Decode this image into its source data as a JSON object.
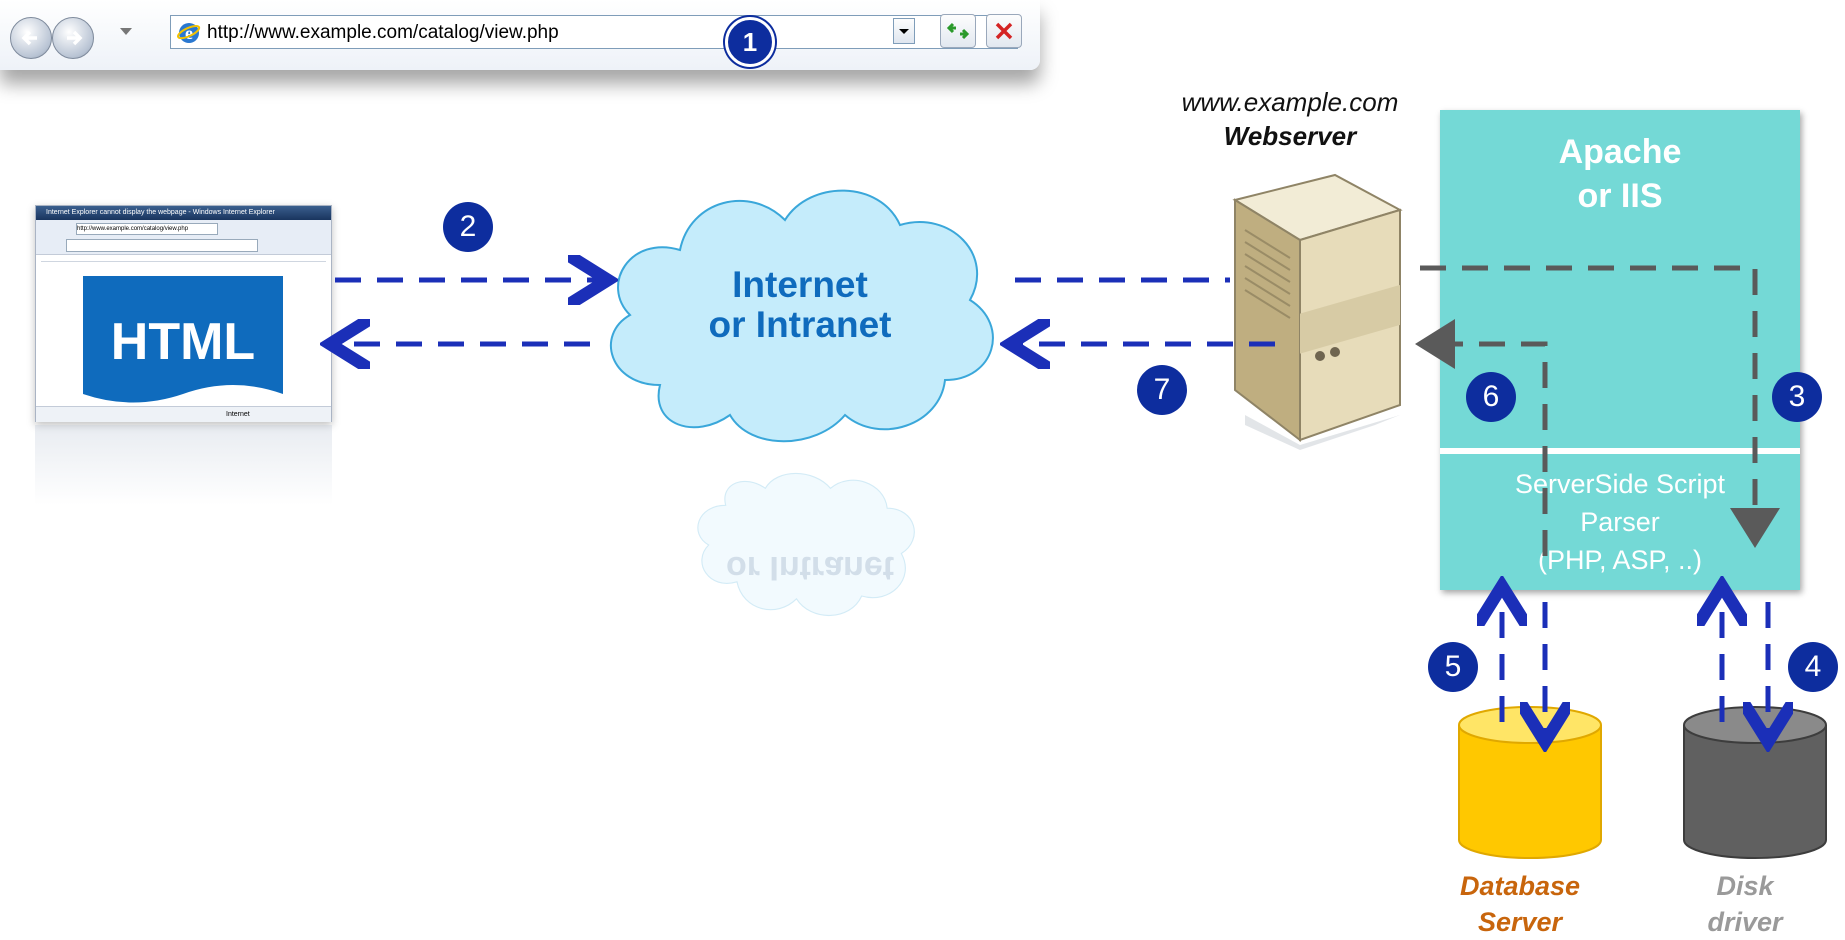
{
  "browser": {
    "url": "http://www.example.com/catalog/view.php",
    "back_icon": "back-arrow-icon",
    "forward_icon": "forward-arrow-icon",
    "dropdown_icon": "chevron-down-icon",
    "refresh_icon": "refresh-icon",
    "stop_icon": "close-icon"
  },
  "steps": {
    "s1": "1",
    "s2": "2",
    "s3": "3",
    "s4": "4",
    "s5": "5",
    "s6": "6",
    "s7": "7"
  },
  "client": {
    "doc_label": "HTML",
    "title_text": "Internet Explorer cannot display the webpage - Windows Internet Explorer",
    "url_text": "http://www.example.com/catalog/view.php",
    "status_text": "Internet"
  },
  "cloud": {
    "line1": "Internet",
    "line2": "or Intranet",
    "reflection": "or Intranet"
  },
  "server": {
    "site": "www.example.com",
    "name": "Webserver"
  },
  "apache": {
    "title_line1": "Apache",
    "title_line2": "or IIS",
    "parser_line1": "ServerSide Script",
    "parser_line2": "Parser",
    "parser_line3": "(PHP, ASP, ..)"
  },
  "storage": {
    "db_line1": "Database",
    "db_line2": "Server",
    "disk_line1": "Disk",
    "disk_line2": "driver"
  },
  "colors": {
    "step_circle": "#0d2d9e",
    "arrow_blue": "#1b2fb8",
    "arrow_gray": "#5a5a5a",
    "apache_box": "#74d9d6",
    "html_blue": "#0f6bbd",
    "db_yellow": "#ffcc00",
    "disk_gray": "#606060"
  }
}
